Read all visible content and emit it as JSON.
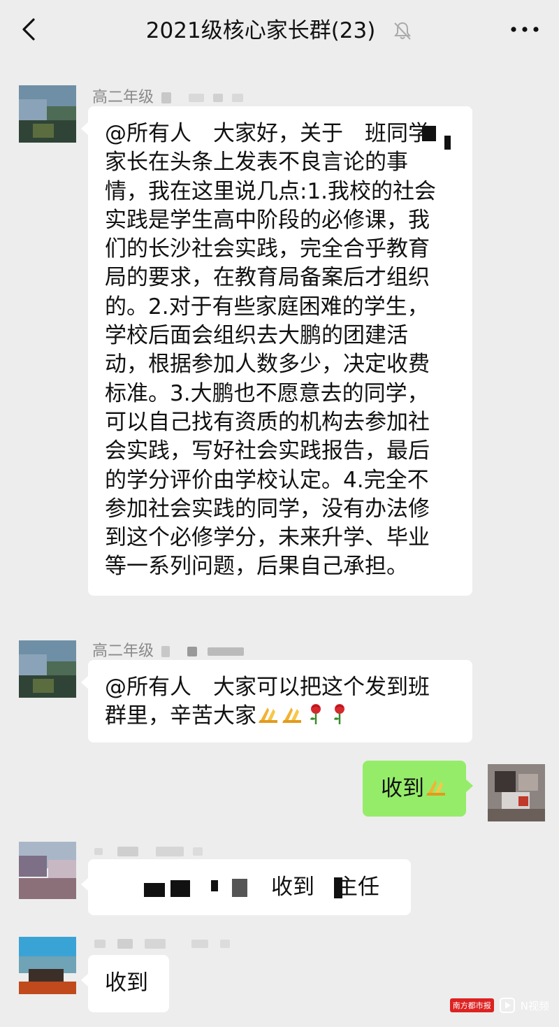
{
  "header": {
    "title": "2021级核心家长群(23)"
  },
  "messages": [
    {
      "sender": "高二年级",
      "lines": [
        "@所有人　大家好，关于　班同学",
        "家长在头条上发表不良言论的事",
        "情，我在这里说几点:1.我校的社会",
        "实践是学生高中阶段的必修课，我",
        "们的长沙社会实践，完全合乎教育",
        "局的要求，在教育局备案后才组织",
        "的。2.对于有些家庭困难的学生，",
        "学校后面会组织去大鹏的团建活",
        "动，根据参加人数多少，决定收费",
        "标准。3.大鹏也不愿意去的同学，",
        "可以自己找有资质的机构去参加社",
        "会实践，写好社会实践报告，最后",
        "的学分评价由学校认定。4.完全不",
        "参加社会实践的同学，没有办法修",
        "到这个必修学分，未来升学、毕业",
        "等一系列问题，后果自己承担。"
      ]
    },
    {
      "sender": "高二年级",
      "lines": [
        "@所有人　大家可以把这个发到班",
        "群里，辛苦大家"
      ]
    },
    {
      "self": true,
      "text": "收到"
    },
    {
      "text": "收到　主任"
    },
    {
      "text": "收到"
    }
  ],
  "watermark": {
    "brand": "N视频",
    "badge": "南方都市报"
  },
  "icons": [
    "back-arrow-icon",
    "mute-bell-icon",
    "more-dots-icon",
    "pray-hands-emoji",
    "rose-emoji"
  ],
  "colors": {
    "background": "#ededed",
    "self_bubble": "#95ec69",
    "other_bubble": "#ffffff"
  }
}
